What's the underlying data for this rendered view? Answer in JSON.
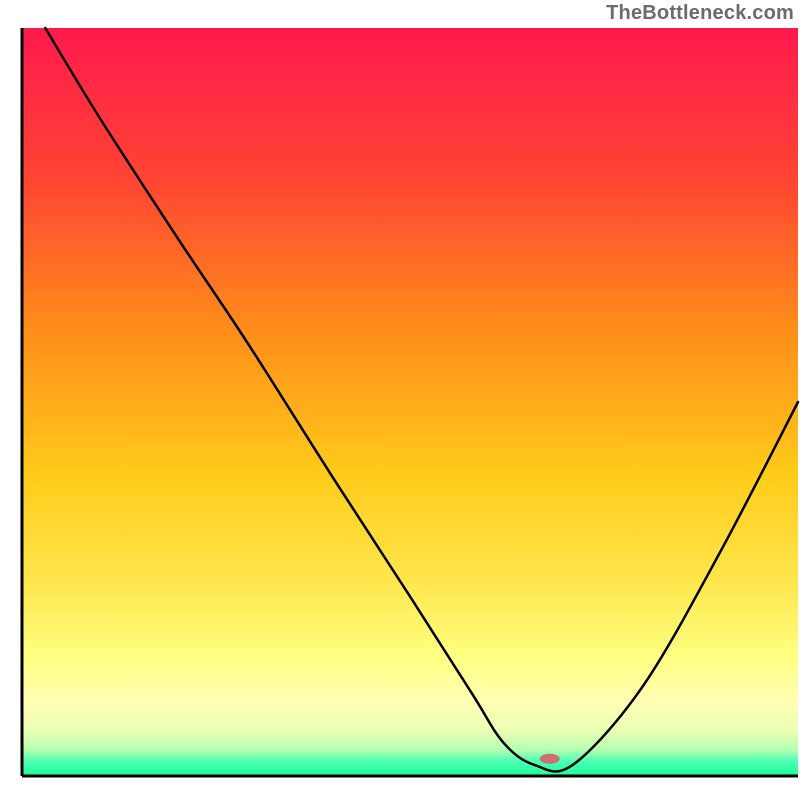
{
  "watermark": "TheBottleneck.com",
  "chart_data": {
    "type": "line",
    "title": "",
    "xlabel": "",
    "ylabel": "",
    "xlim": [
      0,
      100
    ],
    "ylim": [
      0,
      100
    ],
    "x": [
      3,
      10,
      20,
      29,
      40,
      50,
      58,
      62,
      66,
      71,
      80,
      90,
      100
    ],
    "values": [
      100,
      88,
      72,
      58,
      40,
      24,
      11,
      4.5,
      1.5,
      1.5,
      12,
      30,
      50
    ],
    "marker": {
      "x": 68,
      "y": 2.3,
      "color": "#cf6f6f",
      "rx": 10,
      "ry": 5
    },
    "grid": false,
    "legend": false,
    "axes_visible": true,
    "axes_color": "#000000",
    "axes_width": 3,
    "line_color": "#000000",
    "gradient_stops": [
      {
        "offset": 0.0,
        "color": "#ff1a4d"
      },
      {
        "offset": 0.2,
        "color": "#ff4433"
      },
      {
        "offset": 0.4,
        "color": "#ff8c1a"
      },
      {
        "offset": 0.6,
        "color": "#ffcc1a"
      },
      {
        "offset": 0.74,
        "color": "#ffe64d"
      },
      {
        "offset": 0.84,
        "color": "#ffff80"
      },
      {
        "offset": 0.9,
        "color": "#ffffb3"
      },
      {
        "offset": 0.94,
        "color": "#eaffb3"
      },
      {
        "offset": 0.965,
        "color": "#b3ffb3"
      },
      {
        "offset": 0.98,
        "color": "#4dffb3"
      },
      {
        "offset": 1.0,
        "color": "#1aff99"
      }
    ]
  }
}
